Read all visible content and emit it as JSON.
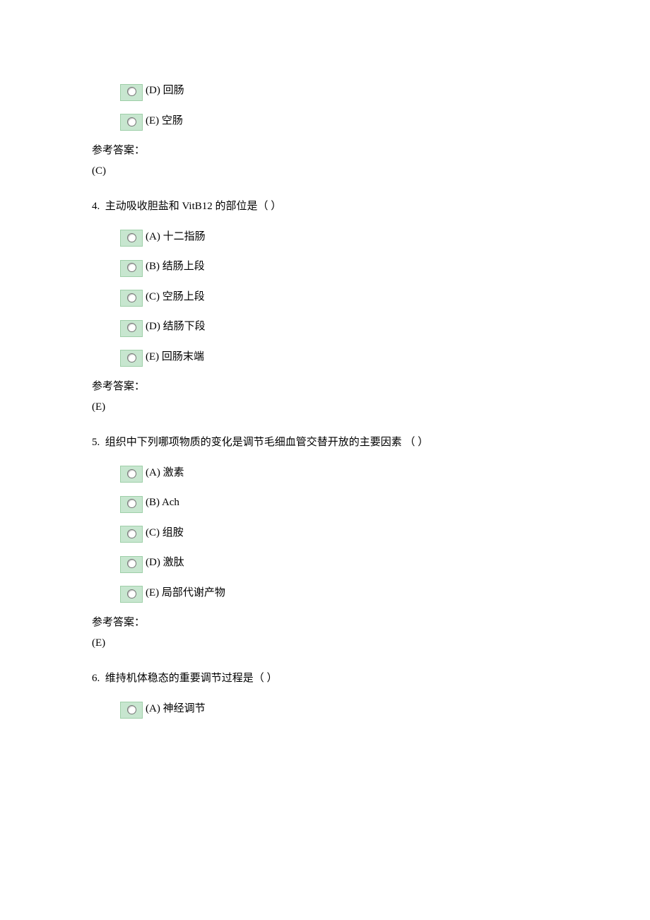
{
  "labels": {
    "answer_label": "参考答案："
  },
  "q3_tail": {
    "options": [
      {
        "letter": "(D)",
        "text": "回肠"
      },
      {
        "letter": "(E)",
        "text": "空肠"
      }
    ],
    "answer": "(C)"
  },
  "q4": {
    "number": "4.",
    "stem": "主动吸收胆盐和 VitB12 的部位是（  ）",
    "options": [
      {
        "letter": "(A)",
        "text": "十二指肠"
      },
      {
        "letter": "(B)",
        "text": "结肠上段"
      },
      {
        "letter": "(C)",
        "text": "空肠上段"
      },
      {
        "letter": "(D)",
        "text": "结肠下段"
      },
      {
        "letter": "(E)",
        "text": "回肠末端"
      }
    ],
    "answer": "(E)"
  },
  "q5": {
    "number": "5.",
    "stem": "组织中下列哪项物质的变化是调节毛细血管交替开放的主要因素 （  ）",
    "options": [
      {
        "letter": "(A)",
        "text": "激素"
      },
      {
        "letter": "(B)",
        "text": "Ach"
      },
      {
        "letter": "(C)",
        "text": "组胺"
      },
      {
        "letter": "(D)",
        "text": "激肽"
      },
      {
        "letter": "(E)",
        "text": "局部代谢产物"
      }
    ],
    "answer": "(E)"
  },
  "q6": {
    "number": "6.",
    "stem": "维持机体稳态的重要调节过程是（  ）",
    "options": [
      {
        "letter": "(A)",
        "text": "神经调节"
      }
    ]
  }
}
